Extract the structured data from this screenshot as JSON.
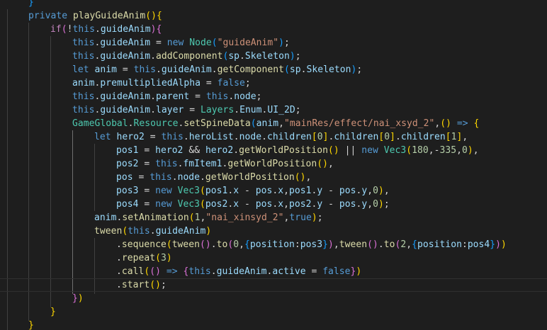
{
  "editor": {
    "background": "#1e1e1e",
    "lines": [
      "}",
      "private playGuideAnim(){",
      "if(!this.guideAnim){",
      "this.guideAnim = new Node(\"guideAnim\");",
      "this.guideAnim.addComponent(sp.Skeleton);",
      "let anim = this.guideAnim.getComponent(sp.Skeleton);",
      "anim.premultipliedAlpha = false;",
      "this.guideAnim.parent = this.node;",
      "this.guideAnim.layer = Layers.Enum.UI_2D;",
      "GameGlobal.Resource.setSpineData(anim,\"mainRes/effect/nai_xsyd_2\",() => {",
      "let hero2 = this.heroList.node.children[0].children[0].children[1],",
      "pos1 = hero2 && hero2.getWorldPosition() || new Vec3(180,-335,0),",
      "pos2 = this.fmItem1.getWorldPosition(),",
      "pos = this.node.getWorldPosition(),",
      "pos3 = new Vec3(pos1.x - pos.x,pos1.y - pos.y,0),",
      "pos4 = new Vec3(pos2.x - pos.x,pos2.y - pos.y,0);",
      "anim.setAnimation(1,\"nai_xinsyd_2\",true);",
      "tween(this.guideAnim)",
      ".sequence(tween().to(0,{position:pos3}),tween().to(2,{position:pos4}))",
      ".repeat(3)",
      ".call(() => {this.guideAnim.active = false})",
      ".start();",
      "})",
      "}",
      "}"
    ]
  },
  "theme": {
    "keyword": "#569cd6",
    "control": "#c586c0",
    "function": "#dcdcaa",
    "variable": "#9cdcfe",
    "class": "#4ec9b0",
    "string": "#ce9178",
    "number": "#b5cea8",
    "bracket_level_1": "#ffd700",
    "bracket_level_2": "#da70d6",
    "bracket_level_3": "#179fff"
  },
  "cursor": {
    "line": 22,
    "column": 15
  }
}
